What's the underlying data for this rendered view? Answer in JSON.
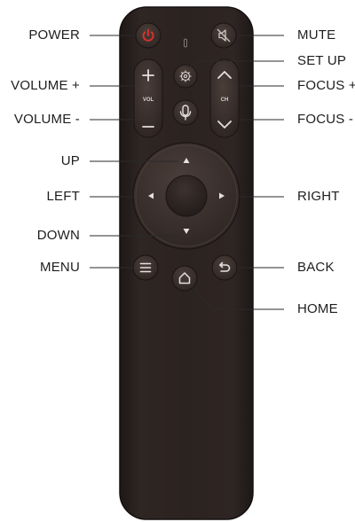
{
  "labels": {
    "power": "POWER",
    "mute": "MUTE",
    "set_up": "SET UP",
    "volume_plus": "VOLUME +",
    "focus_plus": "FOCUS +",
    "volume_minus": "VOLUME -",
    "focus_minus": "FOCUS -",
    "up": "UP",
    "left": "LEFT",
    "right": "RIGHT",
    "down": "DOWN",
    "menu": "MENU",
    "back": "BACK",
    "home": "HOME"
  },
  "remote": {
    "vol_label": "VOL",
    "ch_label": "CH"
  },
  "colors": {
    "body": "#2b2220",
    "button": "#3a2f2c",
    "power_icon": "#e0312c"
  },
  "icons": [
    "power-icon",
    "mute-icon",
    "gear-icon",
    "mic-icon",
    "plus-icon",
    "minus-icon",
    "chevron-up-icon",
    "chevron-down-icon",
    "arrow-up-icon",
    "arrow-down-icon",
    "arrow-left-icon",
    "arrow-right-icon",
    "menu-icon",
    "back-icon",
    "home-icon"
  ]
}
